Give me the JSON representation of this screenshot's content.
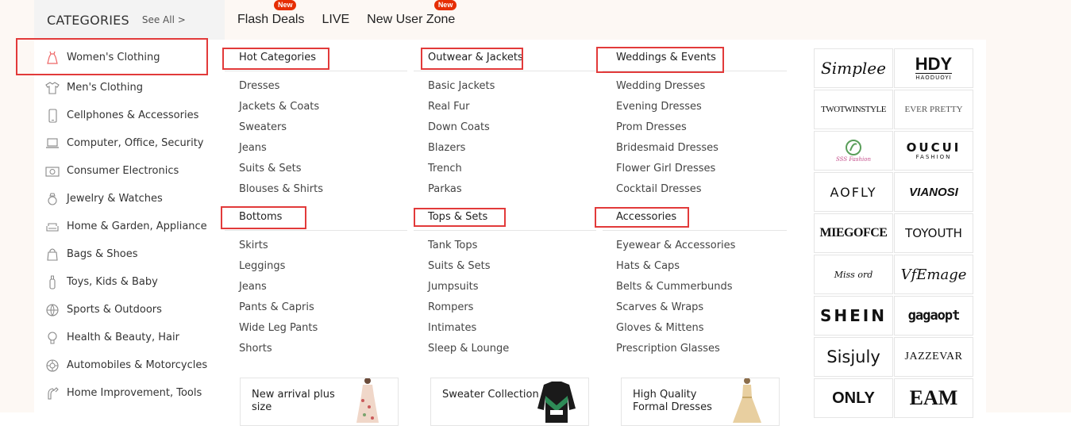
{
  "header": {
    "categories_title": "CATEGORIES",
    "see_all": "See All >",
    "nav": [
      {
        "label": "Flash Deals",
        "badge": "New"
      },
      {
        "label": "LIVE",
        "badge": ""
      },
      {
        "label": "New User Zone",
        "badge": "New"
      }
    ]
  },
  "sidebar": {
    "items": [
      {
        "label": "Women's Clothing",
        "icon": "dress-icon"
      },
      {
        "label": "Men's Clothing",
        "icon": "shirt-icon"
      },
      {
        "label": "Cellphones & Accessories",
        "icon": "phone-icon"
      },
      {
        "label": "Computer, Office, Security",
        "icon": "laptop-icon"
      },
      {
        "label": "Consumer Electronics",
        "icon": "camera-icon"
      },
      {
        "label": "Jewelry & Watches",
        "icon": "ring-icon"
      },
      {
        "label": "Home & Garden, Appliance",
        "icon": "sofa-icon"
      },
      {
        "label": "Bags & Shoes",
        "icon": "bag-icon"
      },
      {
        "label": "Toys, Kids & Baby",
        "icon": "bottle-icon"
      },
      {
        "label": "Sports & Outdoors",
        "icon": "ball-icon"
      },
      {
        "label": "Health & Beauty, Hair",
        "icon": "bulb-icon"
      },
      {
        "label": "Automobiles & Motorcycles",
        "icon": "wheel-icon"
      },
      {
        "label": "Home Improvement, Tools",
        "icon": "tool-icon"
      }
    ]
  },
  "columns": [
    {
      "groups": [
        {
          "title": "Hot Categories",
          "links": [
            "Dresses",
            "Jackets & Coats",
            "Sweaters",
            "Jeans",
            "Suits & Sets",
            "Blouses & Shirts"
          ]
        },
        {
          "title": "Bottoms",
          "links": [
            "Skirts",
            "Leggings",
            "Jeans",
            "Pants & Capris",
            "Wide Leg Pants",
            "Shorts"
          ]
        }
      ]
    },
    {
      "groups": [
        {
          "title": "Outwear & Jackets",
          "links": [
            "Basic Jackets",
            "Real Fur",
            "Down Coats",
            "Blazers",
            "Trench",
            "Parkas"
          ]
        },
        {
          "title": "Tops & Sets",
          "links": [
            "Tank Tops",
            "Suits & Sets",
            "Jumpsuits",
            "Rompers",
            "Intimates",
            "Sleep & Lounge"
          ]
        }
      ]
    },
    {
      "groups": [
        {
          "title": "Weddings & Events",
          "links": [
            "Wedding Dresses",
            "Evening Dresses",
            "Prom Dresses",
            "Bridesmaid Dresses",
            "Flower Girl Dresses",
            "Cocktail Dresses"
          ]
        },
        {
          "title": "Accessories",
          "links": [
            "Eyewear & Accessories",
            "Hats & Caps",
            "Belts & Cummerbunds",
            "Scarves & Wraps",
            "Gloves & Mittens",
            "Prescription Glasses"
          ]
        }
      ]
    }
  ],
  "promos": [
    {
      "line1": "New arrival plus",
      "line2": "size"
    },
    {
      "line1": "Sweater Collection",
      "line2": ""
    },
    {
      "line1": "High Quality",
      "line2": "Formal Dresses"
    }
  ],
  "brands": [
    {
      "name": "Simplee",
      "sub": ""
    },
    {
      "name": "HDY",
      "sub": "HAODUOYI"
    },
    {
      "name": "TWOTWINSTYLE",
      "sub": ""
    },
    {
      "name": "EVER PRETTY",
      "sub": ""
    },
    {
      "name": "SSS Fashion",
      "sub": ""
    },
    {
      "name": "OUCUI",
      "sub": "FASHION"
    },
    {
      "name": "AOFLY",
      "sub": ""
    },
    {
      "name": "VIANOSI",
      "sub": ""
    },
    {
      "name": "MIEGOFCE",
      "sub": ""
    },
    {
      "name": "TOYOUTH",
      "sub": ""
    },
    {
      "name": "Miss ord",
      "sub": ""
    },
    {
      "name": "VfEmage",
      "sub": ""
    },
    {
      "name": "SHEIN",
      "sub": ""
    },
    {
      "name": "gagaopt",
      "sub": ""
    },
    {
      "name": "Sisjuly",
      "sub": ""
    },
    {
      "name": "JAZZEVAR",
      "sub": ""
    },
    {
      "name": "ONLY",
      "sub": ""
    },
    {
      "name": "EAM",
      "sub": ""
    }
  ],
  "colors": {
    "accent": "#e62e04",
    "highlight_box": "#e23a3a",
    "sidebar_header": "#f3f3f3",
    "page_band": "#fdf8f4"
  }
}
